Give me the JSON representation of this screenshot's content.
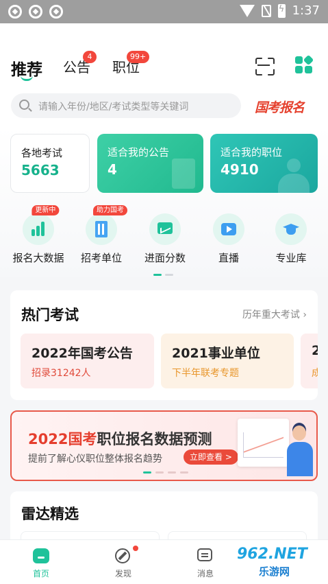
{
  "status_bar": {
    "time": "1:37"
  },
  "header": {
    "tabs": [
      {
        "label": "推荐"
      },
      {
        "label": "公告",
        "badge": "4"
      },
      {
        "label": "职位",
        "badge": "99+"
      }
    ],
    "scan_icon": "scan-icon",
    "apps_icon": "apps-grid-icon",
    "search": {
      "placeholder": "请输入年份/地区/考试类型等关键词"
    },
    "promo_logo": "国考报名"
  },
  "stats": [
    {
      "label": "各地考试",
      "value": "5663"
    },
    {
      "label": "适合我的公告",
      "value": "4"
    },
    {
      "label": "适合我的职位",
      "value": "4910"
    }
  ],
  "quick_entries": [
    {
      "label": "报名大数据",
      "tag": "更新中",
      "icon": "bar-chart-icon"
    },
    {
      "label": "招考单位",
      "tag": "助力国考",
      "icon": "building-icon"
    },
    {
      "label": "进面分数",
      "icon": "screen-chart-icon"
    },
    {
      "label": "直播",
      "icon": "tv-play-icon"
    },
    {
      "label": "专业库",
      "icon": "graduation-cap-icon"
    }
  ],
  "hot_exams": {
    "title": "热门考试",
    "more": "历年重大考试",
    "items": [
      {
        "name": "2022年国考公告",
        "sub": "招录31242人"
      },
      {
        "name": "2021事业单位",
        "sub": "下半年联考专题"
      },
      {
        "name": "2",
        "sub": "成"
      }
    ]
  },
  "banner": {
    "title_highlight": "2022国考",
    "title_rest": "职位报名数据预测",
    "subtitle": "提前了解心仪职位整体报名趋势",
    "button": "立即查看 >"
  },
  "radar": {
    "title": "雷达精选"
  },
  "bottom_nav": [
    {
      "label": "首页",
      "icon": "home-icon"
    },
    {
      "label": "发现",
      "icon": "compass-icon"
    },
    {
      "label": "消息",
      "icon": "message-icon"
    }
  ],
  "watermark": {
    "main": "962.NET",
    "sub": "乐游网"
  },
  "colors": {
    "accent": "#1fc29a",
    "badge": "#f2473c",
    "banner_red": "#e53e2e"
  }
}
